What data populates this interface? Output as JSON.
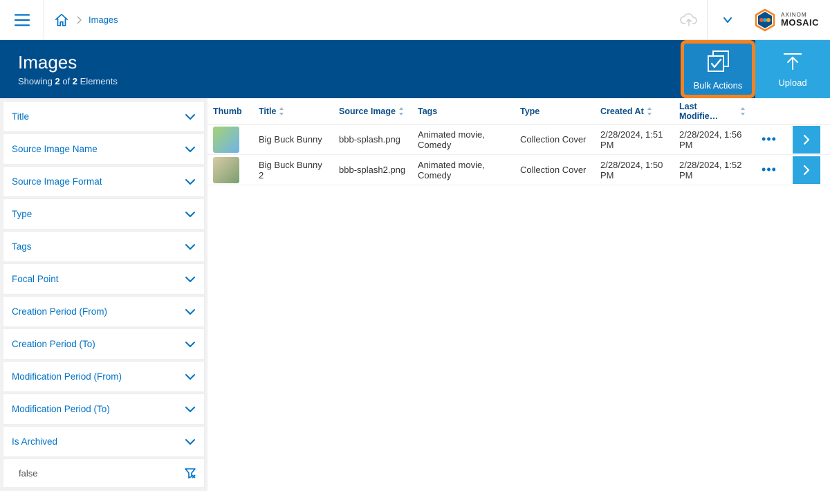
{
  "breadcrumb": {
    "current": "Images"
  },
  "logo": {
    "line1": "AXINOM",
    "line2": "MOSAIC"
  },
  "header": {
    "title": "Images",
    "sub_prefix": "Showing ",
    "count1": "2",
    "sub_mid": " of ",
    "count2": "2",
    "sub_suffix": " Elements"
  },
  "actions": {
    "bulk": "Bulk Actions",
    "upload": "Upload"
  },
  "filters": [
    {
      "label": "Title"
    },
    {
      "label": "Source Image Name"
    },
    {
      "label": "Source Image Format"
    },
    {
      "label": "Type"
    },
    {
      "label": "Tags"
    },
    {
      "label": "Focal Point"
    },
    {
      "label": "Creation Period (From)"
    },
    {
      "label": "Creation Period (To)"
    },
    {
      "label": "Modification Period (From)"
    },
    {
      "label": "Modification Period (To)"
    },
    {
      "label": "Is Archived"
    }
  ],
  "filter_archived_value": "false",
  "columns": {
    "thumb": "Thumb",
    "title": "Title",
    "source": "Source Image",
    "tags": "Tags",
    "type": "Type",
    "created": "Created At",
    "modified": "Last Modifie…"
  },
  "rows": [
    {
      "title": "Big Buck Bunny",
      "source": "bbb-splash.png",
      "tags": "Animated movie, Comedy",
      "type": "Collection Cover",
      "created": "2/28/2024, 1:51 PM",
      "modified": "2/28/2024, 1:56 PM",
      "thumb_colors": [
        "#a7d276",
        "#6db3e8"
      ]
    },
    {
      "title": "Big Buck Bunny 2",
      "source": "bbb-splash2.png",
      "tags": "Animated movie, Comedy",
      "type": "Collection Cover",
      "created": "2/28/2024, 1:50 PM",
      "modified": "2/28/2024, 1:52 PM",
      "thumb_colors": [
        "#d9cba6",
        "#7a9e6f"
      ]
    }
  ]
}
